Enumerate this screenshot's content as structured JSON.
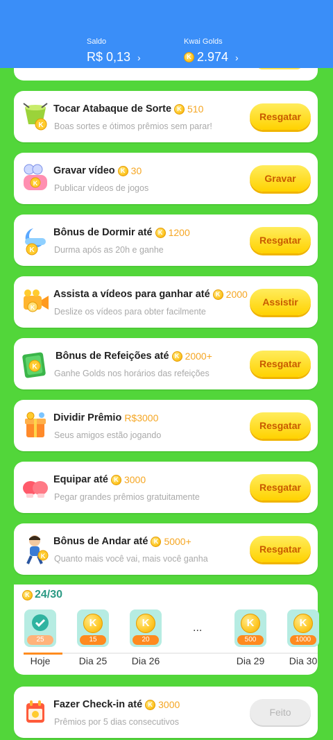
{
  "header": {
    "balance_label": "Saldo",
    "balance_value": "R$ 0,13",
    "golds_label": "Kwai Golds",
    "golds_value": "2.974"
  },
  "tasks": [
    {
      "title": "Tocar Atabaque de Sorte",
      "reward": "510",
      "subtitle": "Boas sortes e ótimos prêmios sem parar!",
      "button": "Resgatar",
      "icon": "drum-icon"
    },
    {
      "title": "Gravar vídeo",
      "reward": "30",
      "subtitle": "Publicar vídeos de jogos",
      "button": "Gravar",
      "icon": "game-controller-icon"
    },
    {
      "title": "Bônus de Dormir até",
      "reward": "1200",
      "subtitle": "Durma após as 20h e ganhe",
      "button": "Resgatar",
      "icon": "moon-icon"
    },
    {
      "title": "Assista a vídeos para ganhar até",
      "reward": "2000",
      "subtitle": "Deslize os vídeos para obter facilmente",
      "button": "Assistir",
      "icon": "video-camera-icon"
    },
    {
      "title": "Bônus de Refeições até",
      "reward": "2000+",
      "subtitle": "Ganhe Golds nos horários das refeições",
      "button": "Resgatar",
      "icon": "meal-box-icon"
    },
    {
      "title": "Dividir Prêmio",
      "reward": "R$3000",
      "subtitle": "Seus amigos estão jogando",
      "button": "Resgatar",
      "icon": "gift-box-icon"
    },
    {
      "title": "Equipar até",
      "reward": "3000",
      "subtitle": "Pegar grandes prêmios gratuitamente",
      "button": "Resgatar",
      "icon": "boxing-gloves-icon"
    },
    {
      "title": "Bônus de Andar até",
      "reward": "5000+",
      "subtitle": "Quanto mais você vai, mais você ganha",
      "button": "Resgatar",
      "icon": "walking-boy-icon"
    }
  ],
  "checkin": {
    "progress": "24/30",
    "days": [
      {
        "label": "Hoje",
        "amount": "25",
        "done": true
      },
      {
        "label": "Dia 25",
        "amount": "15",
        "done": false
      },
      {
        "label": "Dia 26",
        "amount": "20",
        "done": false
      },
      {
        "label": "Dia 29",
        "amount": "500",
        "done": false
      },
      {
        "label": "Dia 30",
        "amount": "1000",
        "done": false
      }
    ],
    "ellipsis": "...",
    "coin_letter": "K"
  },
  "bottom_task": {
    "title": "Fazer Check-in até",
    "reward": "3000",
    "subtitle": "Prêmios por 5 dias consecutivos",
    "button": "Feito",
    "icon": "calendar-icon"
  },
  "colors": {
    "header_bg": "#3a8ef8",
    "page_bg": "#52d63a",
    "button_yellow": "#ffd200",
    "reward_orange": "#f5a623"
  }
}
